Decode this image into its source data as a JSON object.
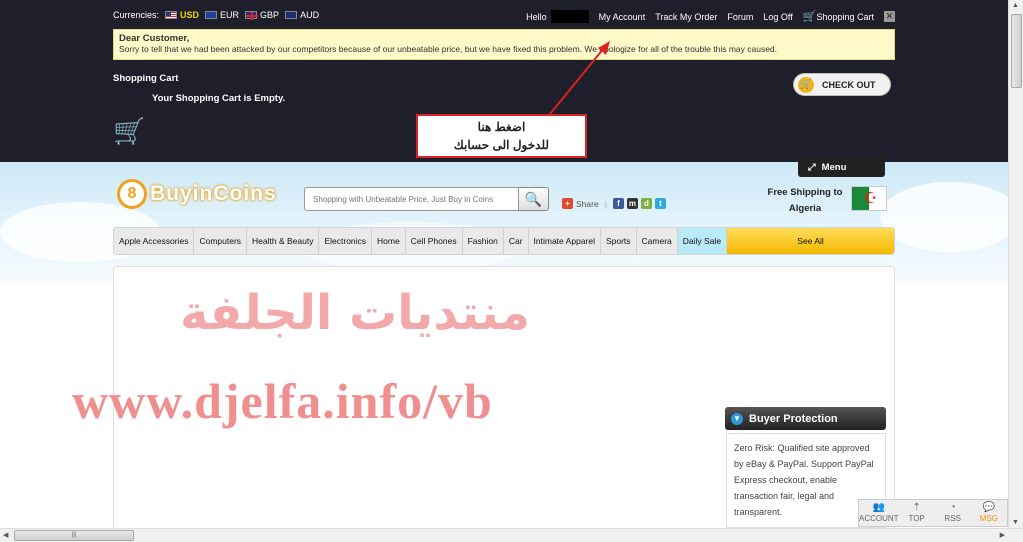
{
  "topbar": {
    "currencies_label": "Currencies:",
    "currencies": [
      {
        "code": "USD",
        "flag": "us-flag-icon",
        "selected": true
      },
      {
        "code": "EUR",
        "flag": "eu-flag-icon",
        "selected": false
      },
      {
        "code": "GBP",
        "flag": "gb-flag-icon",
        "selected": false
      },
      {
        "code": "AUD",
        "flag": "au-flag-icon",
        "selected": false
      }
    ],
    "hello": "Hello",
    "my_account": "My Account",
    "track_order": "Track My Order",
    "forum": "Forum",
    "log_off": "Log Off",
    "shopping_cart": "Shopping Cart"
  },
  "notice": {
    "title": "Dear Customer,",
    "text": "Sorry to tell that we had been attacked by our competitors because of our unbeatable price, but we have fixed this problem. We apologize for all of the trouble this may caused."
  },
  "cart": {
    "heading": "Shopping Cart",
    "empty": "Your Shopping Cart is Empty.",
    "checkout": "CHECK OUT"
  },
  "annotation": {
    "line1": "اضغط هنا",
    "line2": "للدخول الى حسابك"
  },
  "menu_tab": "Menu",
  "logo": {
    "coin": "8",
    "word": "BuyinCoins"
  },
  "search": {
    "placeholder": "Shopping with Unbeatable Price, Just Buy in Coins"
  },
  "share": {
    "label": "Share"
  },
  "shipping": {
    "line1": "Free Shipping to",
    "line2": "Algeria"
  },
  "nav": [
    "Apple Accessories",
    "Computers",
    "Health & Beauty",
    "Electronics",
    "Home",
    "Cell Phones",
    "Fashion",
    "Car",
    "Intimate Apparel",
    "Sports",
    "Camera",
    "Daily Sale",
    "See All"
  ],
  "watermark": {
    "arabic": "منتديات الجلفة",
    "url": "www.djelfa.info/vb"
  },
  "buyer_protection": {
    "title": "Buyer Protection",
    "body": "Zero Risk: Qualified site approved by eBay & PayPal. Support PayPal Express checkout, enable transaction fair, legal and transparent."
  },
  "floatbar": {
    "account": "ACCOUNT",
    "top": "TOP",
    "rss": "RSS",
    "msg": "MSG"
  },
  "colors": {
    "topband": "#1e1f2a",
    "notice_bg": "#fff8c8",
    "accent_yellow": "#f5b900",
    "annotation_red": "#dd2222"
  }
}
